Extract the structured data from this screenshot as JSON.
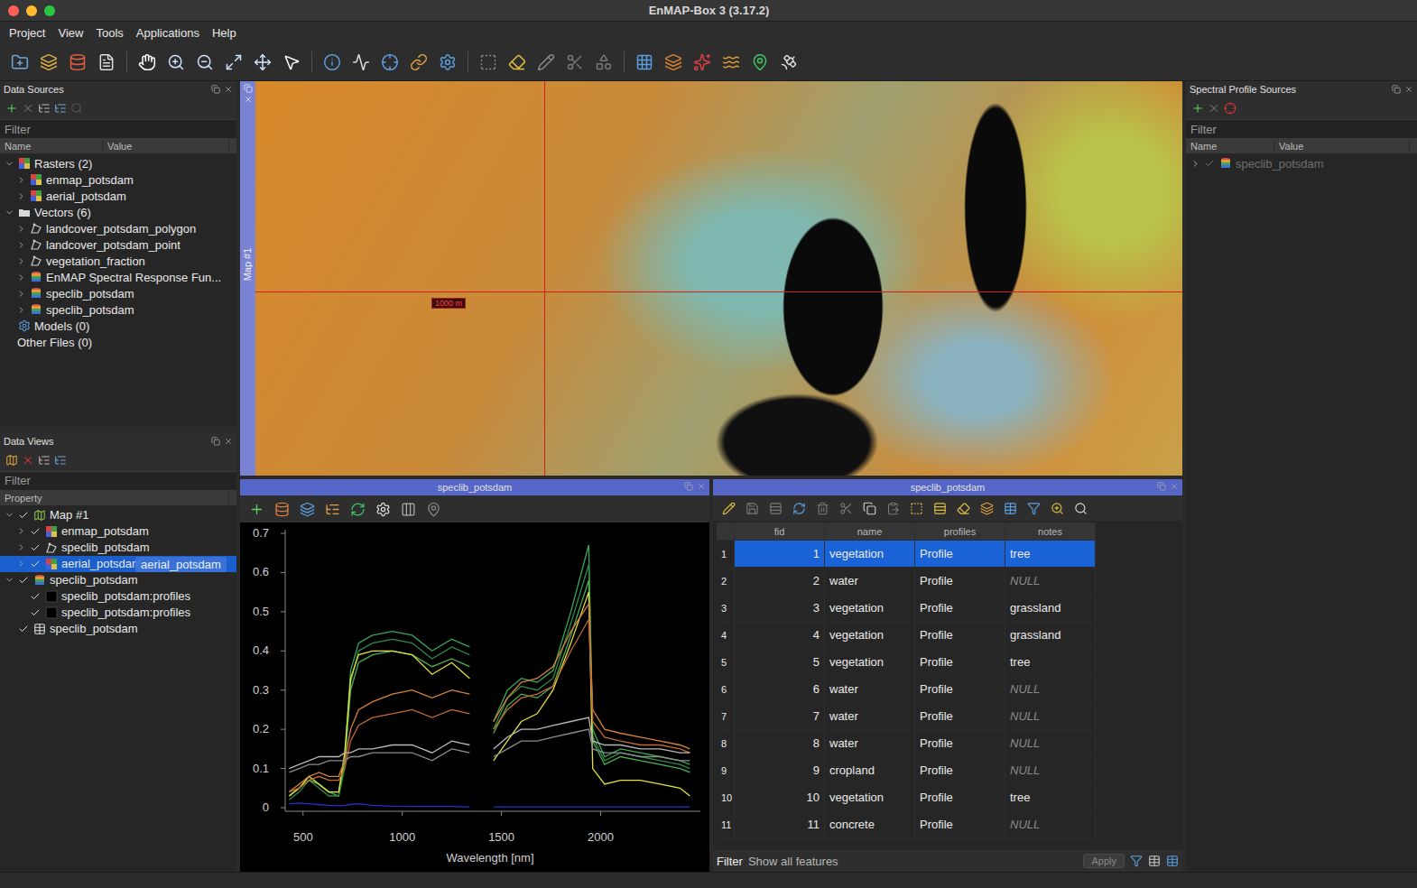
{
  "window": {
    "title": "EnMAP-Box 3 (3.17.2)"
  },
  "menu": [
    "Project",
    "View",
    "Tools",
    "Applications",
    "Help"
  ],
  "data_sources": {
    "title": "Data Sources",
    "filter_placeholder": "Filter",
    "columns": [
      "Name",
      "Value"
    ],
    "items": [
      {
        "label": "Rasters (2)",
        "level": 0,
        "expandable": true,
        "expanded": true,
        "kind": "rastergroup"
      },
      {
        "label": "enmap_potsdam",
        "level": 1,
        "expandable": true,
        "expanded": false,
        "kind": "raster"
      },
      {
        "label": "aerial_potsdam",
        "level": 1,
        "expandable": true,
        "expanded": false,
        "kind": "raster"
      },
      {
        "label": "Vectors (6)",
        "level": 0,
        "expandable": true,
        "expanded": true,
        "kind": "folder"
      },
      {
        "label": "landcover_potsdam_polygon",
        "level": 1,
        "expandable": true,
        "expanded": false,
        "kind": "vector"
      },
      {
        "label": "landcover_potsdam_point",
        "level": 1,
        "expandable": true,
        "expanded": false,
        "kind": "vector"
      },
      {
        "label": "vegetation_fraction",
        "level": 1,
        "expandable": true,
        "expanded": false,
        "kind": "vector"
      },
      {
        "label": "EnMAP Spectral Response Fun...",
        "level": 1,
        "expandable": true,
        "expanded": false,
        "kind": "speclib"
      },
      {
        "label": "speclib_potsdam",
        "level": 1,
        "expandable": true,
        "expanded": false,
        "kind": "speclib"
      },
      {
        "label": "speclib_potsdam",
        "level": 1,
        "expandable": true,
        "expanded": false,
        "kind": "speclib"
      },
      {
        "label": "Models (0)",
        "level": 0,
        "expandable": false,
        "expanded": false,
        "kind": "model"
      },
      {
        "label": "Other Files (0)",
        "level": 0,
        "expandable": false,
        "expanded": false,
        "kind": "none"
      }
    ]
  },
  "data_views": {
    "title": "Data Views",
    "filter_placeholder": "Filter",
    "columns": [
      "Property"
    ],
    "items": [
      {
        "label": "Map #1",
        "level": 0,
        "expandable": true,
        "expanded": true,
        "checked": true,
        "selected": false,
        "kind": "map"
      },
      {
        "label": "enmap_potsdam",
        "level": 1,
        "expandable": true,
        "expanded": false,
        "checked": true,
        "selected": false,
        "kind": "raster"
      },
      {
        "label": "speclib_potsdam",
        "level": 1,
        "expandable": true,
        "expanded": false,
        "checked": true,
        "selected": false,
        "kind": "vector"
      },
      {
        "label": "aerial_potsdam",
        "level": 1,
        "expandable": true,
        "expanded": false,
        "checked": true,
        "selected": true,
        "kind": "raster"
      },
      {
        "label": "speclib_potsdam",
        "level": 0,
        "expandable": true,
        "expanded": true,
        "checked": true,
        "selected": false,
        "kind": "speclib"
      },
      {
        "label": "speclib_potsdam:profiles",
        "level": 1,
        "expandable": false,
        "expanded": false,
        "checked": true,
        "selected": false,
        "kind": "swatch"
      },
      {
        "label": "speclib_potsdam:profiles",
        "level": 1,
        "expandable": false,
        "expanded": false,
        "checked": true,
        "selected": false,
        "kind": "swatch"
      },
      {
        "label": "speclib_potsdam",
        "level": 0,
        "expandable": false,
        "expanded": false,
        "checked": true,
        "selected": false,
        "kind": "table"
      }
    ],
    "drag_ghost": "aerial_potsdam"
  },
  "profile_sources": {
    "title": "Spectral Profile Sources",
    "filter_placeholder": "Filter",
    "columns": [
      "Name",
      "Value"
    ],
    "items": [
      {
        "label": "speclib_potsdam",
        "level": 0,
        "expandable": true,
        "expanded": false,
        "checked": true,
        "disabled": true,
        "kind": "speclib"
      }
    ]
  },
  "map": {
    "title": "Map #1",
    "scale_label": "1000 m"
  },
  "spectral_view": {
    "title": "speclib_potsdam",
    "chart": {
      "y_ticks": [
        "0.7",
        "0.6",
        "0.5",
        "0.4",
        "0.3",
        "0.2",
        "0.1",
        "0"
      ],
      "x_ticks": [
        "500",
        "1000",
        "1500",
        "2000"
      ],
      "x_label": "Wavelength [nm]",
      "wavelengths": [
        430,
        480,
        530,
        580,
        630,
        680,
        710,
        740,
        780,
        850,
        950,
        1050,
        1150,
        1250,
        1340,
        1460,
        1530,
        1600,
        1680,
        1760,
        1850,
        1940,
        1960,
        2020,
        2100,
        2200,
        2300,
        2400,
        2450
      ],
      "series": [
        {
          "color": "#3aa655",
          "values": [
            0.03,
            0.05,
            0.08,
            0.06,
            0.04,
            0.03,
            0.12,
            0.35,
            0.42,
            0.44,
            0.45,
            0.44,
            0.4,
            0.43,
            0.41,
            0.22,
            0.3,
            0.33,
            0.32,
            0.35,
            0.5,
            0.67,
            0.2,
            0.13,
            0.15,
            0.14,
            0.13,
            0.12,
            0.11
          ]
        },
        {
          "color": "#2e8b4a",
          "values": [
            0.02,
            0.04,
            0.07,
            0.05,
            0.03,
            0.03,
            0.1,
            0.32,
            0.4,
            0.42,
            0.43,
            0.42,
            0.38,
            0.41,
            0.39,
            0.2,
            0.28,
            0.31,
            0.3,
            0.33,
            0.47,
            0.62,
            0.18,
            0.12,
            0.14,
            0.13,
            0.12,
            0.11,
            0.1
          ]
        },
        {
          "color": "#4cb050",
          "values": [
            0.03,
            0.05,
            0.07,
            0.06,
            0.04,
            0.04,
            0.12,
            0.3,
            0.37,
            0.39,
            0.4,
            0.39,
            0.36,
            0.38,
            0.36,
            0.19,
            0.26,
            0.29,
            0.28,
            0.31,
            0.44,
            0.58,
            0.17,
            0.11,
            0.13,
            0.12,
            0.11,
            0.1,
            0.09
          ]
        },
        {
          "color": "#e6e03a",
          "values": [
            0.03,
            0.05,
            0.08,
            0.06,
            0.04,
            0.04,
            0.14,
            0.33,
            0.39,
            0.4,
            0.4,
            0.39,
            0.34,
            0.37,
            0.33,
            0.12,
            0.17,
            0.22,
            0.24,
            0.3,
            0.42,
            0.55,
            0.1,
            0.06,
            0.07,
            0.07,
            0.06,
            0.05,
            0.03
          ]
        },
        {
          "color": "#d9823a",
          "values": [
            0.04,
            0.06,
            0.08,
            0.09,
            0.08,
            0.08,
            0.12,
            0.2,
            0.25,
            0.27,
            0.29,
            0.3,
            0.28,
            0.3,
            0.29,
            0.22,
            0.28,
            0.32,
            0.33,
            0.36,
            0.45,
            0.52,
            0.25,
            0.2,
            0.19,
            0.18,
            0.17,
            0.16,
            0.15
          ]
        },
        {
          "color": "#c06a30",
          "values": [
            0.04,
            0.05,
            0.07,
            0.08,
            0.07,
            0.07,
            0.1,
            0.17,
            0.21,
            0.23,
            0.24,
            0.25,
            0.23,
            0.25,
            0.24,
            0.2,
            0.25,
            0.28,
            0.29,
            0.31,
            0.4,
            0.48,
            0.22,
            0.18,
            0.17,
            0.16,
            0.16,
            0.15,
            0.14
          ]
        },
        {
          "color": "#b8b8b8",
          "values": [
            0.1,
            0.11,
            0.12,
            0.13,
            0.13,
            0.13,
            0.14,
            0.14,
            0.15,
            0.15,
            0.16,
            0.16,
            0.14,
            0.17,
            0.16,
            0.15,
            0.18,
            0.2,
            0.2,
            0.21,
            0.22,
            0.23,
            0.17,
            0.16,
            0.16,
            0.15,
            0.15,
            0.14,
            0.14
          ]
        },
        {
          "color": "#8c8c8c",
          "values": [
            0.09,
            0.1,
            0.11,
            0.11,
            0.12,
            0.12,
            0.12,
            0.13,
            0.13,
            0.14,
            0.14,
            0.14,
            0.12,
            0.15,
            0.14,
            0.13,
            0.15,
            0.17,
            0.17,
            0.18,
            0.19,
            0.2,
            0.15,
            0.14,
            0.14,
            0.13,
            0.13,
            0.12,
            0.12
          ]
        },
        {
          "color": "#2030d0",
          "values": [
            0.01,
            0.012,
            0.01,
            0.008,
            0.006,
            0.005,
            0.006,
            0.008,
            0.01,
            0.006,
            0.004,
            0.003,
            0.003,
            0.003,
            0.002,
            0.002,
            0.002,
            0.002,
            0.002,
            0.002,
            0.002,
            0.002,
            0.002,
            0.002,
            0.002,
            0.002,
            0.002,
            0.002,
            0.002
          ]
        }
      ]
    }
  },
  "attribute_table": {
    "title": "speclib_potsdam",
    "columns": [
      "fid",
      "name",
      "profiles",
      "notes"
    ],
    "rows": [
      {
        "row": "1",
        "fid": "1",
        "name": "vegetation",
        "profiles": "Profile",
        "notes": "tree",
        "notes_null": false,
        "selected": true
      },
      {
        "row": "2",
        "fid": "2",
        "name": "water",
        "profiles": "Profile",
        "notes": "NULL",
        "notes_null": true,
        "selected": false
      },
      {
        "row": "3",
        "fid": "3",
        "name": "vegetation",
        "profiles": "Profile",
        "notes": "grassland",
        "notes_null": false,
        "selected": false
      },
      {
        "row": "4",
        "fid": "4",
        "name": "vegetation",
        "profiles": "Profile",
        "notes": "grassland",
        "notes_null": false,
        "selected": false
      },
      {
        "row": "5",
        "fid": "5",
        "name": "vegetation",
        "profiles": "Profile",
        "notes": "tree",
        "notes_null": false,
        "selected": false
      },
      {
        "row": "6",
        "fid": "6",
        "name": "water",
        "profiles": "Profile",
        "notes": "NULL",
        "notes_null": true,
        "selected": false
      },
      {
        "row": "7",
        "fid": "7",
        "name": "water",
        "profiles": "Profile",
        "notes": "NULL",
        "notes_null": true,
        "selected": false
      },
      {
        "row": "8",
        "fid": "8",
        "name": "water",
        "profiles": "Profile",
        "notes": "NULL",
        "notes_null": true,
        "selected": false
      },
      {
        "row": "9",
        "fid": "9",
        "name": "cropland",
        "profiles": "Profile",
        "notes": "NULL",
        "notes_null": true,
        "selected": false
      },
      {
        "row": "10",
        "fid": "10",
        "name": "vegetation",
        "profiles": "Profile",
        "notes": "tree",
        "notes_null": false,
        "selected": false
      },
      {
        "row": "11",
        "fid": "11",
        "name": "concrete",
        "profiles": "Profile",
        "notes": "NULL",
        "notes_null": true,
        "selected": false
      }
    ],
    "filter_label": "Filter",
    "filter_value": "Show all features",
    "apply": "Apply"
  }
}
